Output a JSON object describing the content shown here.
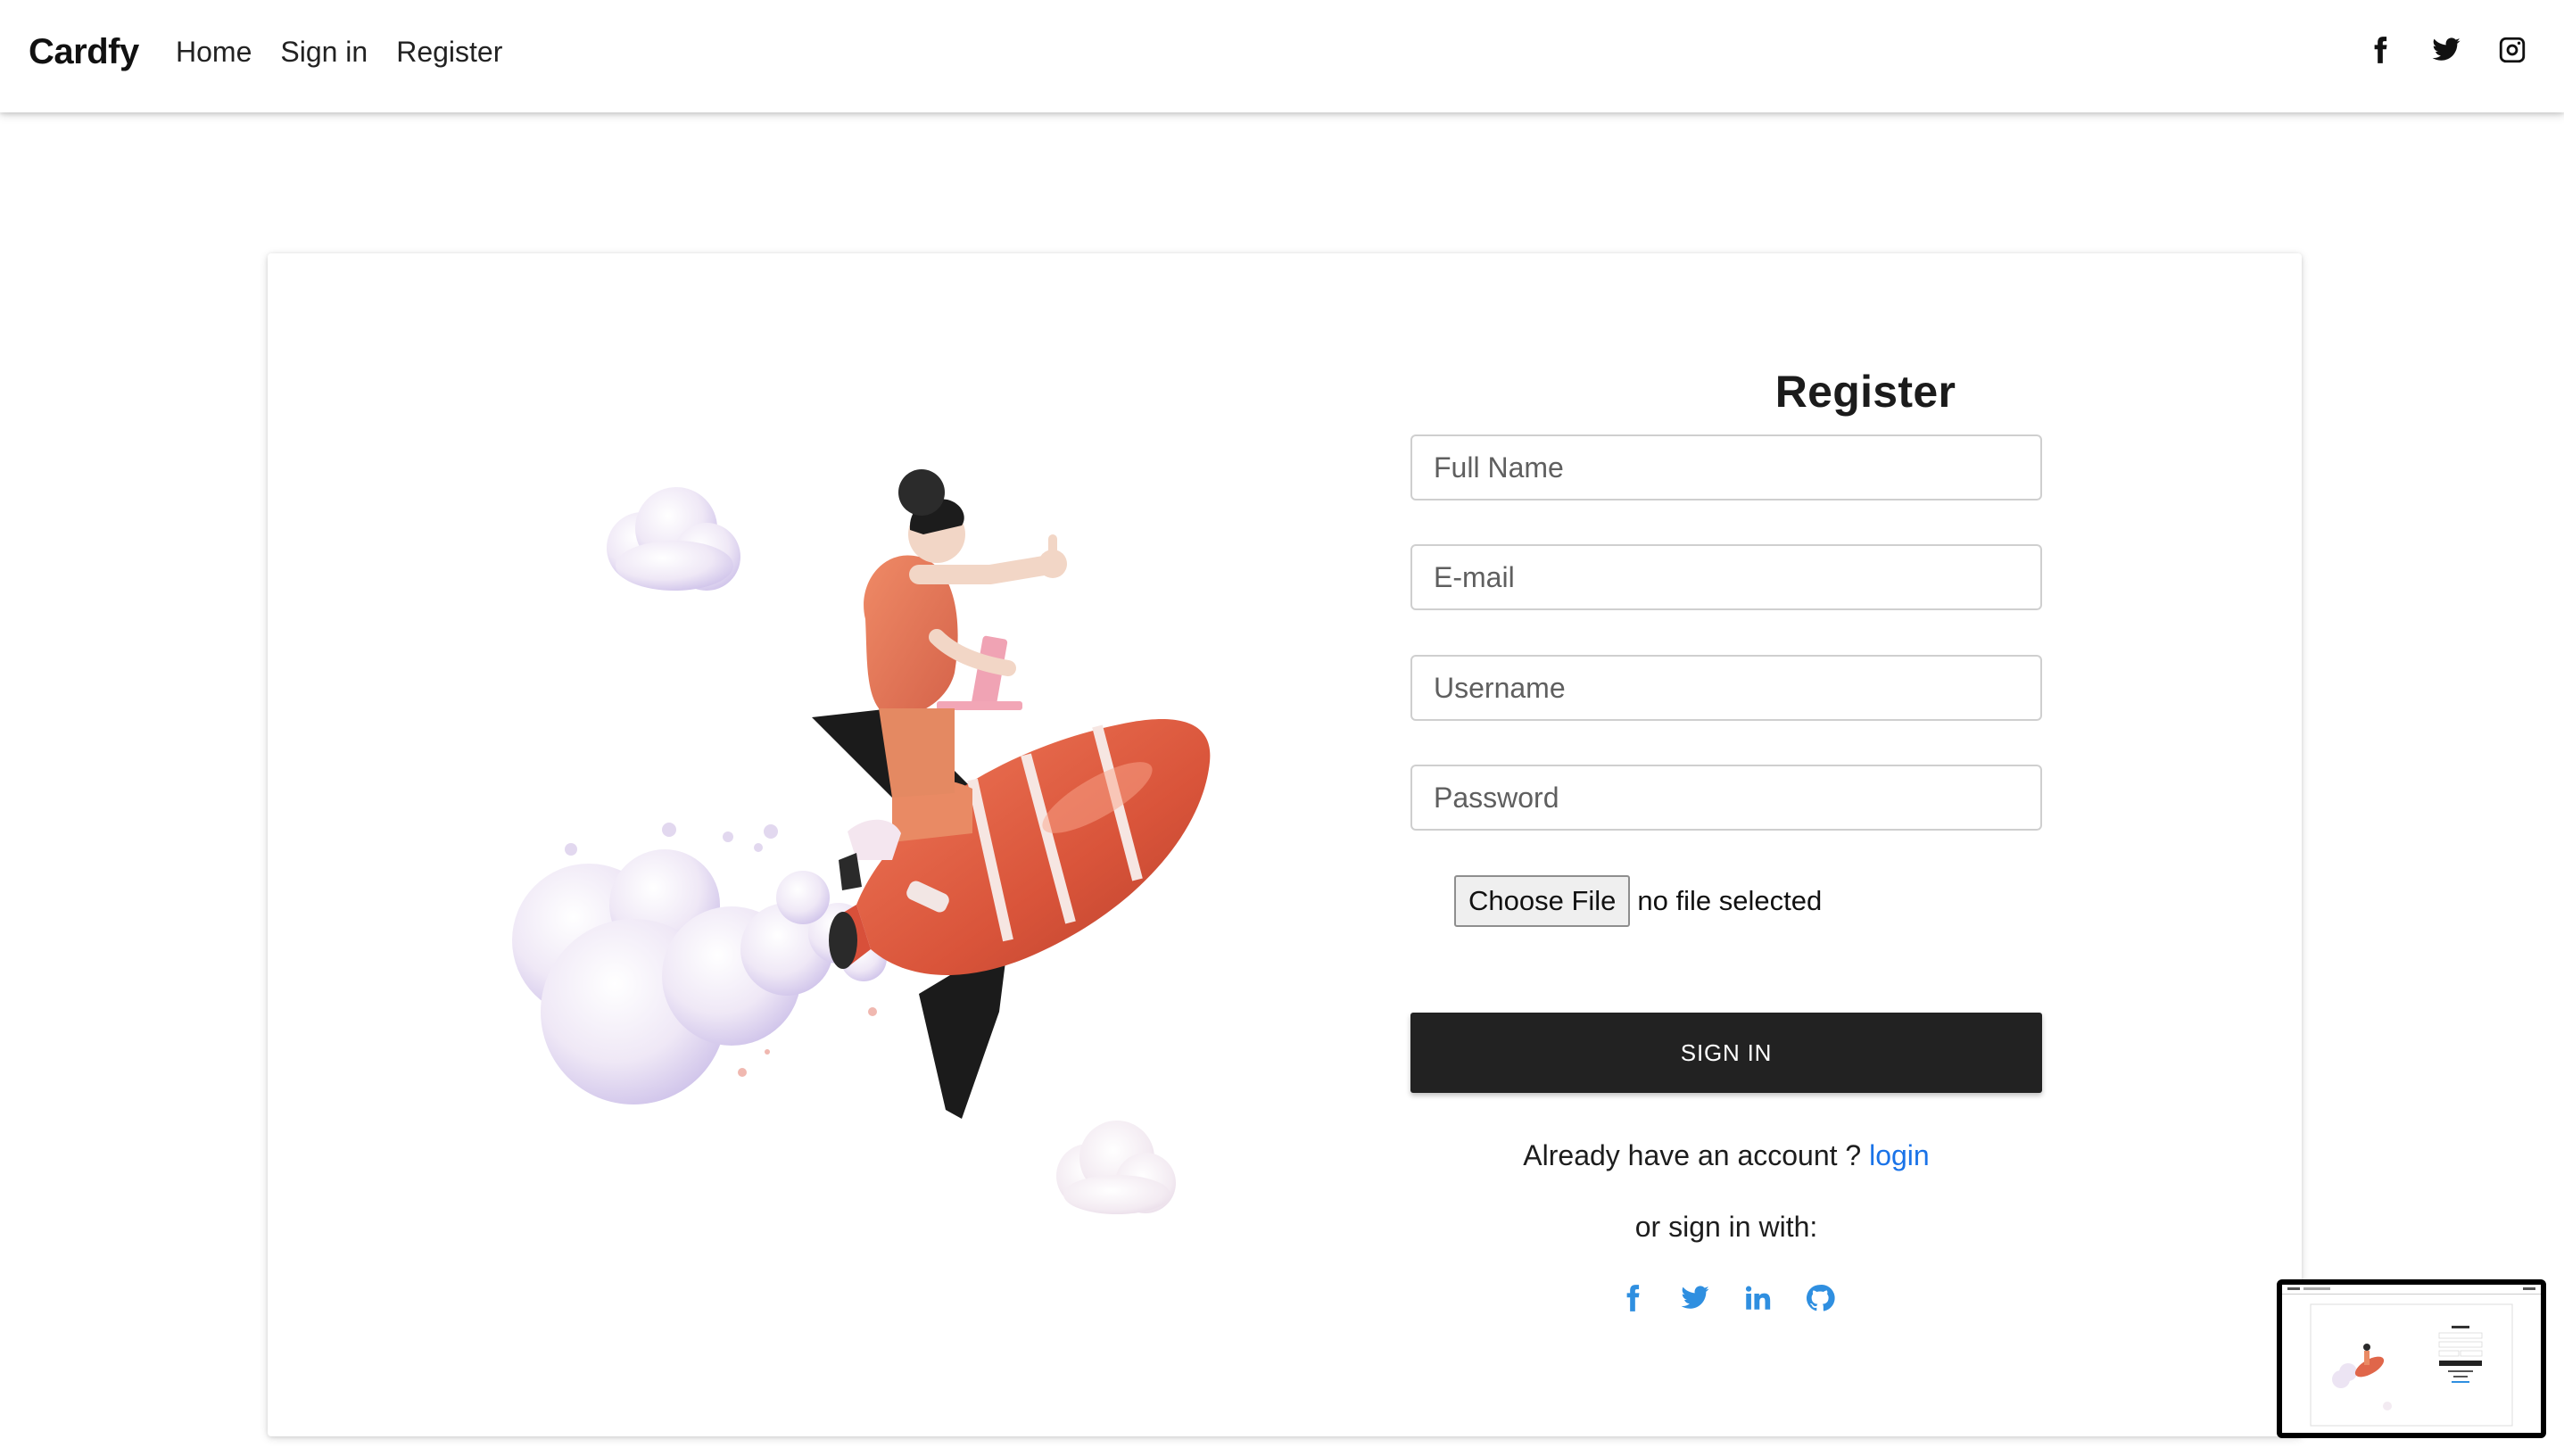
{
  "brand": "Cardfy",
  "nav": {
    "links": [
      "Home",
      "Sign in",
      "Register"
    ],
    "social_icons": [
      "facebook-icon",
      "twitter-icon",
      "instagram-icon"
    ]
  },
  "form": {
    "title": "Register",
    "fields": [
      {
        "name": "full-name",
        "placeholder": "Full Name",
        "value": ""
      },
      {
        "name": "email",
        "placeholder": "E-mail",
        "value": ""
      },
      {
        "name": "username",
        "placeholder": "Username",
        "value": ""
      },
      {
        "name": "password",
        "placeholder": "Password",
        "value": ""
      }
    ],
    "file_button": "Choose File",
    "file_status": "no file selected",
    "submit": "SIGN IN",
    "account_prefix": "Already have an account ?",
    "login_link": "login",
    "or_text": "or sign in with:",
    "social_icons": [
      "facebook-icon",
      "twitter-icon",
      "linkedin-icon",
      "github-icon"
    ]
  },
  "colors": {
    "accent_link": "#1a73e8",
    "button_dark": "#222222",
    "social_blue": "#2f8fe0"
  }
}
